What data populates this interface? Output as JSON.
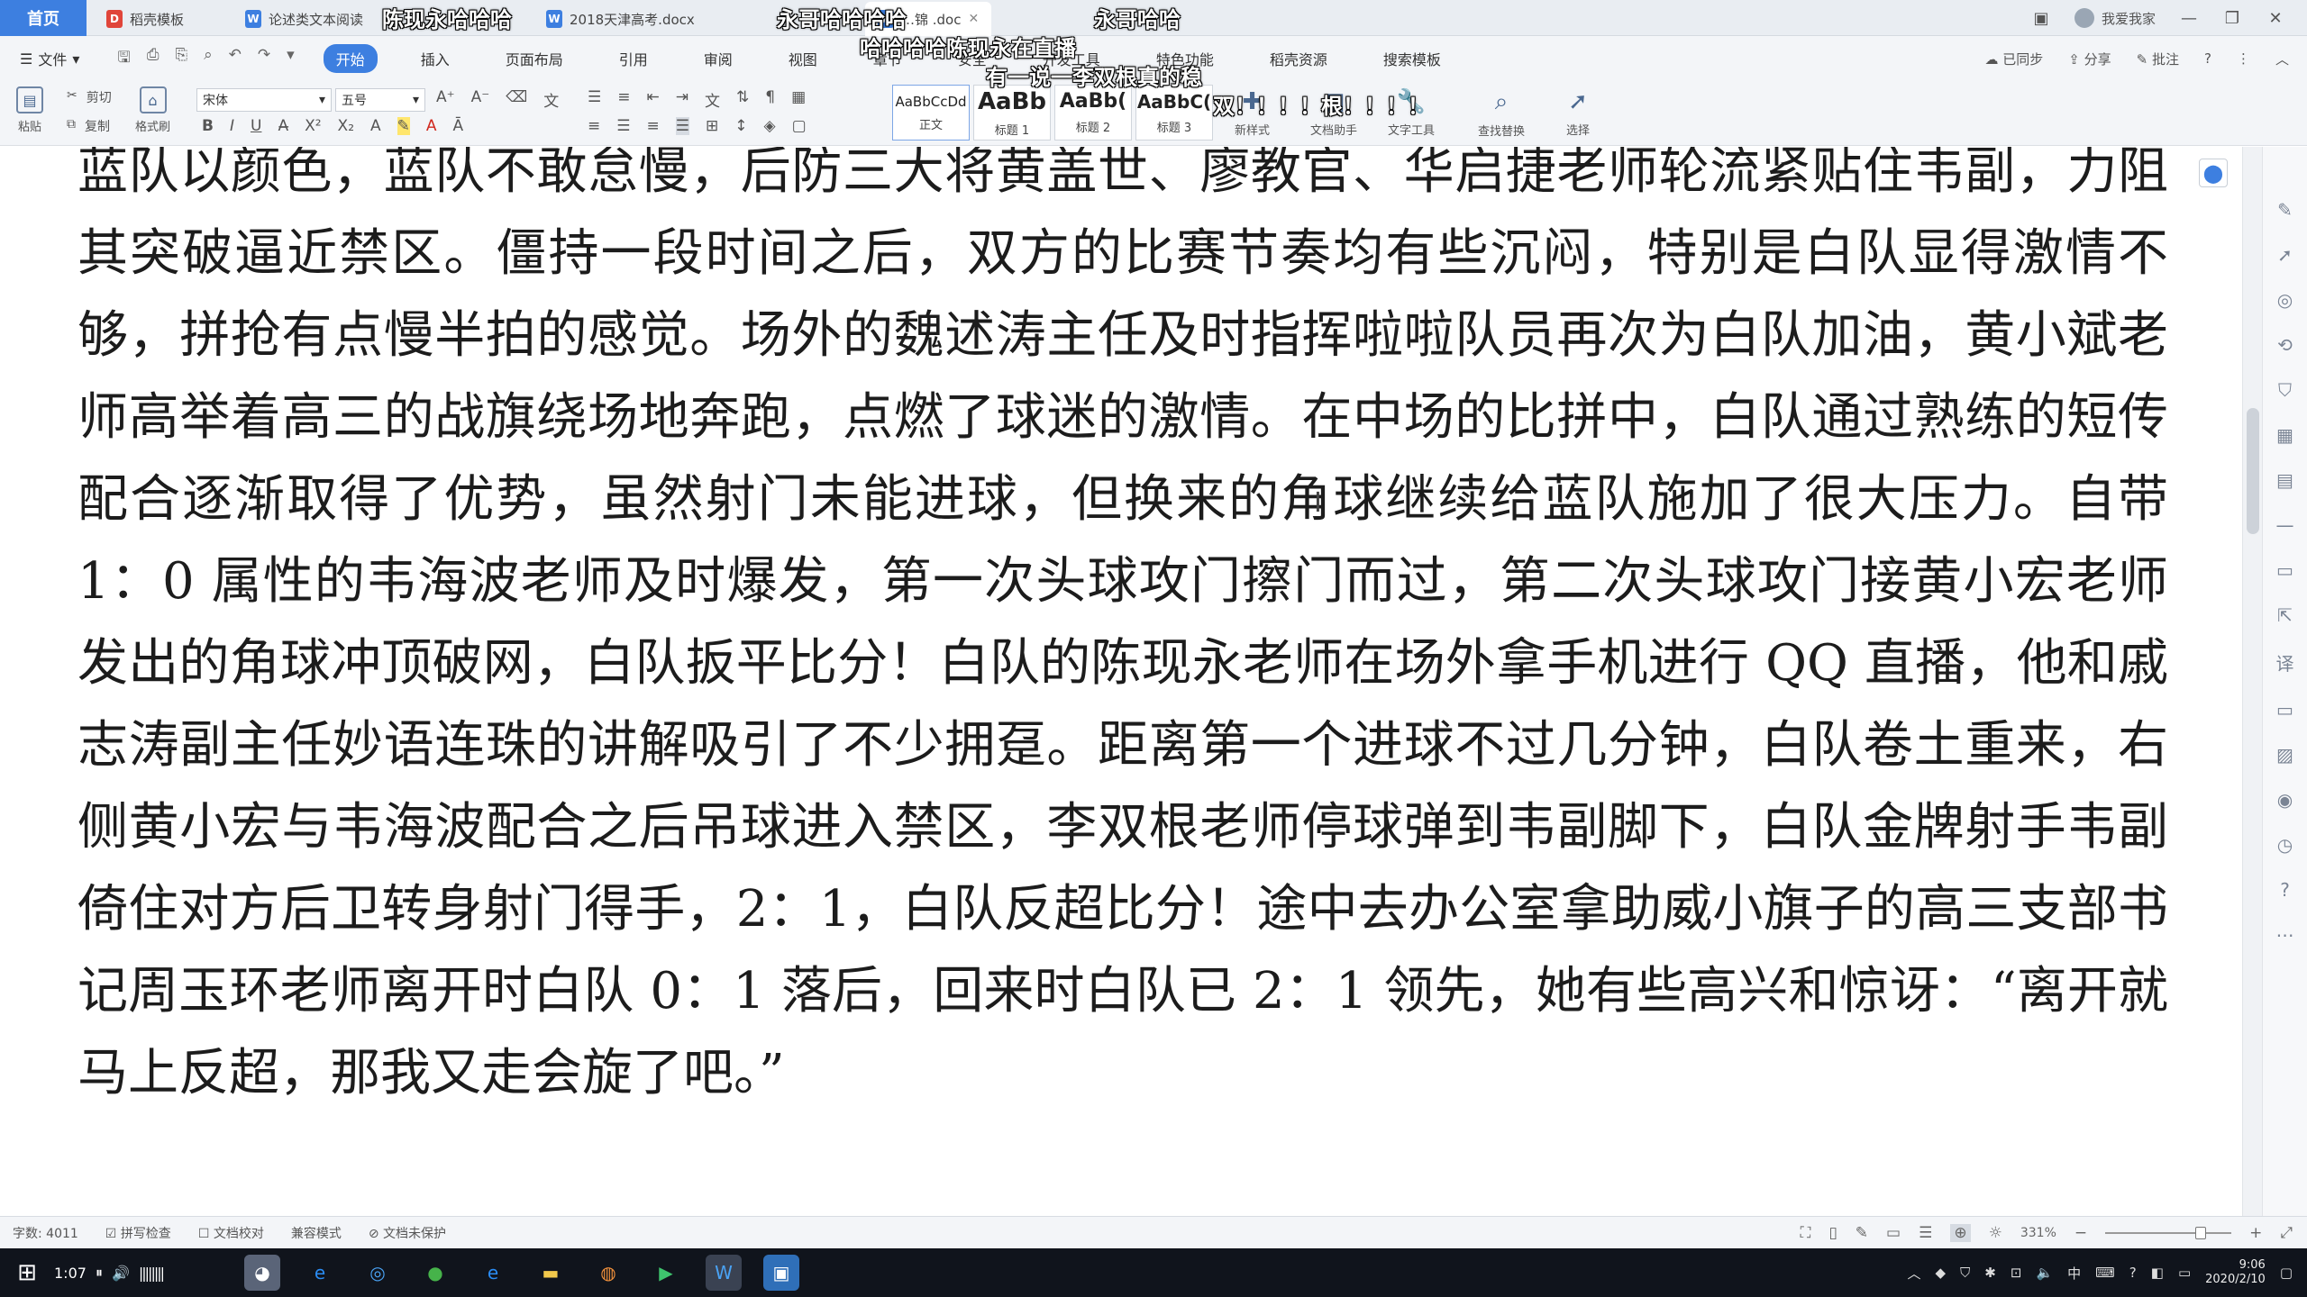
{
  "tabbar": {
    "home_label": "首页",
    "tabs": [
      {
        "label": "稻壳模板",
        "icon": "D",
        "color": "#e0453a"
      },
      {
        "label": "论述类文本阅读",
        "icon": "W",
        "color": "#3d7fe0"
      },
      {
        "label": "2018天津高考.docx",
        "icon": "W",
        "color": "#3d7fe0"
      },
      {
        "label": "…锦 .doc",
        "icon": "W",
        "color": "#3d7fe0"
      }
    ],
    "user": "我爱我家"
  },
  "overlay": {
    "comments": [
      "陈现永哈哈哈",
      "永哥哈哈哈哈",
      "永哥哈哈",
      "哈哈哈哈陈现永在直播",
      "有一说一李双根真的稳",
      "双！！！！根！！！！"
    ]
  },
  "menubar": {
    "file_label": "文件",
    "tabs": [
      "开始",
      "插入",
      "页面布局",
      "引用",
      "审阅",
      "视图",
      "章节",
      "安全",
      "开发工具",
      "特色功能",
      "稻壳资源",
      "搜索模板"
    ],
    "active_tab": "开始",
    "sync": "已同步",
    "share": "分享",
    "comment": "批注"
  },
  "toolbar": {
    "paste": "粘贴",
    "cut": "剪切",
    "copy": "复制",
    "format_painter": "格式刷",
    "font_name": "宋体",
    "font_size": "五号",
    "styles": [
      {
        "sample": "AaBbCcDd",
        "label": "正文"
      },
      {
        "sample": "AaBb",
        "label": "标题 1"
      },
      {
        "sample": "AaBb(",
        "label": "标题 2"
      },
      {
        "sample": "AaBbC(",
        "label": "标题 3"
      }
    ],
    "new_style": "新样式",
    "doc_assistant": "文档助手",
    "text_tools": "文字工具",
    "find_replace": "查找替换",
    "select": "选择"
  },
  "document": {
    "paragraph": "蓝队以颜色，蓝队不敢怠慢，后防三大将黄盖世、廖教官、华启捷老师轮流紧贴住韦副，力阻其突破逼近禁区。僵持一段时间之后，双方的比赛节奏均有些沉闷，特别是白队显得激情不够，拼抢有点慢半拍的感觉。场外的魏述涛主任及时指挥啦啦队员再次为白队加油，黄小斌老师高举着高三的战旗绕场地奔跑，点燃了球迷的激情。在中场的比拼中，白队通过熟练的短传配合逐渐取得了优势，虽然射门未能进球，但换来的角球继续给蓝队施加了很大压力。自带 1：0 属性的韦海波老师及时爆发，第一次头球攻门擦门而过，第二次头球攻门接黄小宏老师发出的角球冲顶破网，白队扳平比分！白队的陈现永老师在场外拿手机进行 QQ 直播，他和戚志涛副主任妙语连珠的讲解吸引了不少拥趸。距离第一个进球不过几分钟，白队卷土重来，右侧黄小宏与韦海波配合之后吊球进入禁区，李双根老师停球弹到韦副脚下，白队金牌射手韦副倚住对方后卫转身射门得手，2：1，白队反超比分！途中去办公室拿助威小旗子的高三支部书记周玉环老师离开时白队 0：1 落后，回来时白队已 2：1 领先，她有些高兴和惊讶：“离开就马上反超，那我又走会旋了吧。”"
  },
  "statusbar": {
    "word_count": "字数: 4011",
    "spell_check": "拼写检查",
    "doc_proof": "文档校对",
    "compat_mode": "兼容模式",
    "doc_protect": "文档未保护",
    "zoom": "331%"
  },
  "taskbar": {
    "time_left": "1:07",
    "clock_time": "9:06",
    "clock_date": "2020/2/10"
  }
}
